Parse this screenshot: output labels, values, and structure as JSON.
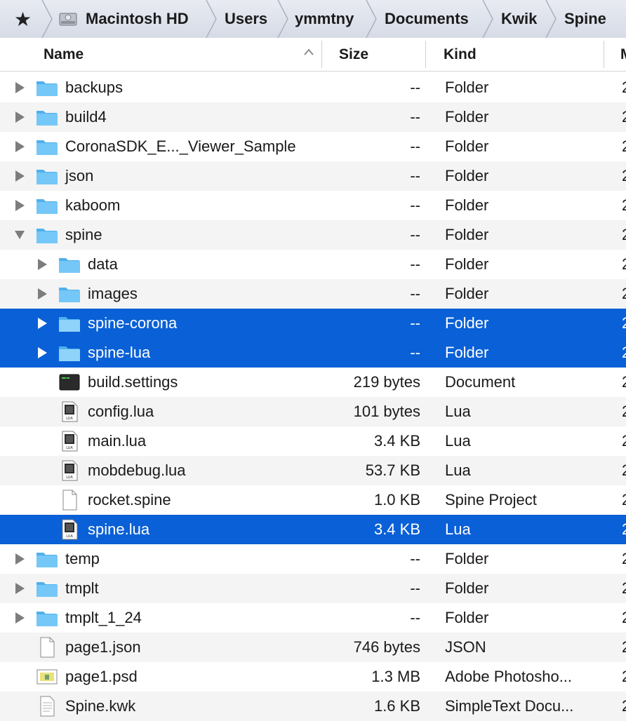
{
  "breadcrumb": {
    "items": [
      "Macintosh HD",
      "Users",
      "ymmtny",
      "Documents",
      "Kwik",
      "Spine"
    ]
  },
  "columns": {
    "name": "Name",
    "size": "Size",
    "kind": "Kind",
    "date_partial": "M"
  },
  "colors": {
    "selection": "#0a60d6",
    "folder": "#6cc3f5",
    "alternate_row": "#f4f4f4"
  },
  "files": [
    {
      "name": "backups",
      "size": "--",
      "kind": "Folder",
      "date_partial": "2",
      "icon": "folder-icon",
      "disclosure": "collapsed",
      "depth": 0,
      "selected": false
    },
    {
      "name": "build4",
      "size": "--",
      "kind": "Folder",
      "date_partial": "2",
      "icon": "folder-icon",
      "disclosure": "collapsed",
      "depth": 0,
      "selected": false
    },
    {
      "name": "CoronaSDK_E..._Viewer_Sample",
      "size": "--",
      "kind": "Folder",
      "date_partial": "2",
      "icon": "folder-icon",
      "disclosure": "collapsed",
      "depth": 0,
      "selected": false
    },
    {
      "name": "json",
      "size": "--",
      "kind": "Folder",
      "date_partial": "2",
      "icon": "folder-icon",
      "disclosure": "collapsed",
      "depth": 0,
      "selected": false
    },
    {
      "name": "kaboom",
      "size": "--",
      "kind": "Folder",
      "date_partial": "2",
      "icon": "folder-icon",
      "disclosure": "collapsed",
      "depth": 0,
      "selected": false
    },
    {
      "name": "spine",
      "size": "--",
      "kind": "Folder",
      "date_partial": "2",
      "icon": "folder-icon",
      "disclosure": "expanded",
      "depth": 0,
      "selected": false
    },
    {
      "name": "data",
      "size": "--",
      "kind": "Folder",
      "date_partial": "2",
      "icon": "folder-icon",
      "disclosure": "collapsed",
      "depth": 1,
      "selected": false
    },
    {
      "name": "images",
      "size": "--",
      "kind": "Folder",
      "date_partial": "2",
      "icon": "folder-icon",
      "disclosure": "collapsed",
      "depth": 1,
      "selected": false
    },
    {
      "name": "spine-corona",
      "size": "--",
      "kind": "Folder",
      "date_partial": "2",
      "icon": "folder-icon",
      "disclosure": "collapsed",
      "depth": 1,
      "selected": true
    },
    {
      "name": "spine-lua",
      "size": "--",
      "kind": "Folder",
      "date_partial": "2",
      "icon": "folder-icon",
      "disclosure": "collapsed",
      "depth": 1,
      "selected": true
    },
    {
      "name": "build.settings",
      "size": "219 bytes",
      "kind": "Document",
      "date_partial": "2",
      "icon": "terminal-document-icon",
      "disclosure": "none",
      "depth": 1,
      "selected": false
    },
    {
      "name": "config.lua",
      "size": "101 bytes",
      "kind": "Lua",
      "date_partial": "2",
      "icon": "lua-file-icon",
      "disclosure": "none",
      "depth": 1,
      "selected": false
    },
    {
      "name": "main.lua",
      "size": "3.4 KB",
      "kind": "Lua",
      "date_partial": "2",
      "icon": "lua-file-icon",
      "disclosure": "none",
      "depth": 1,
      "selected": false
    },
    {
      "name": "mobdebug.lua",
      "size": "53.7 KB",
      "kind": "Lua",
      "date_partial": "2",
      "icon": "lua-file-icon",
      "disclosure": "none",
      "depth": 1,
      "selected": false
    },
    {
      "name": "rocket.spine",
      "size": "1.0 KB",
      "kind": "Spine Project",
      "date_partial": "2",
      "icon": "blank-document-icon",
      "disclosure": "none",
      "depth": 1,
      "selected": false
    },
    {
      "name": "spine.lua",
      "size": "3.4 KB",
      "kind": "Lua",
      "date_partial": "2",
      "icon": "lua-file-icon",
      "disclosure": "none",
      "depth": 1,
      "selected": true
    },
    {
      "name": "temp",
      "size": "--",
      "kind": "Folder",
      "date_partial": "2",
      "icon": "folder-icon",
      "disclosure": "collapsed",
      "depth": 0,
      "selected": false
    },
    {
      "name": "tmplt",
      "size": "--",
      "kind": "Folder",
      "date_partial": "2",
      "icon": "folder-icon",
      "disclosure": "collapsed",
      "depth": 0,
      "selected": false
    },
    {
      "name": "tmplt_1_24",
      "size": "--",
      "kind": "Folder",
      "date_partial": "2",
      "icon": "folder-icon",
      "disclosure": "collapsed",
      "depth": 0,
      "selected": false
    },
    {
      "name": "page1.json",
      "size": "746 bytes",
      "kind": "JSON",
      "date_partial": "2",
      "icon": "blank-document-icon",
      "disclosure": "none",
      "depth": 0,
      "selected": false
    },
    {
      "name": "page1.psd",
      "size": "1.3 MB",
      "kind": "Adobe Photosho...",
      "date_partial": "2",
      "icon": "image-file-icon",
      "disclosure": "none",
      "depth": 0,
      "selected": false
    },
    {
      "name": "Spine.kwk",
      "size": "1.6 KB",
      "kind": "SimpleText Docu...",
      "date_partial": "2",
      "icon": "text-document-icon",
      "disclosure": "none",
      "depth": 0,
      "selected": false
    }
  ]
}
